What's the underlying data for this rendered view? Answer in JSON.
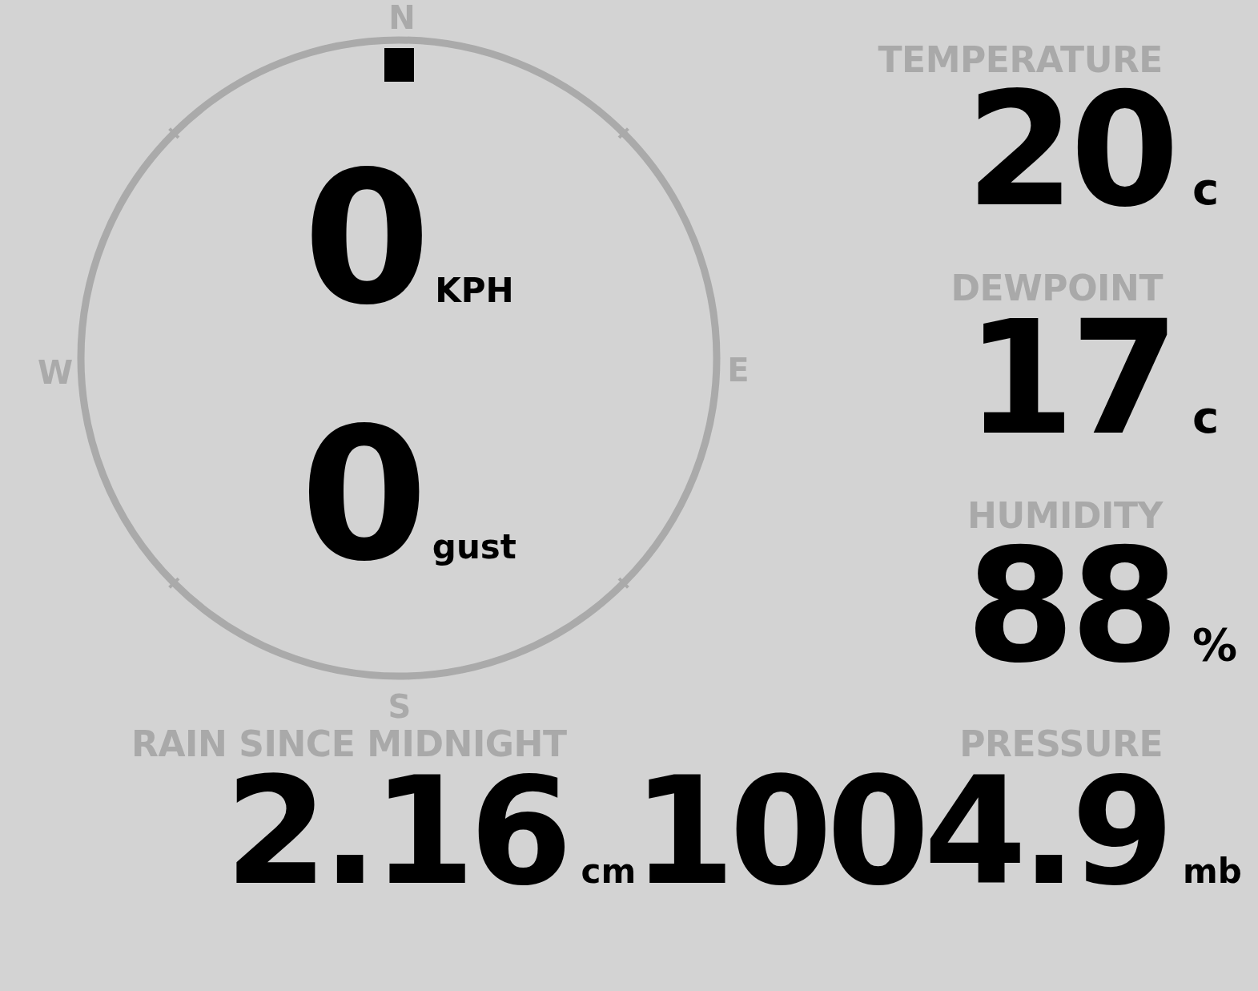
{
  "compass": {
    "labels": [
      "N",
      "E",
      "S",
      "W"
    ]
  },
  "wind": [
    {
      "value": "0",
      "unit": "KPH"
    },
    {
      "value": "0",
      "unit": "gust"
    }
  ],
  "readings": [
    {
      "label": "TEMPERATURE",
      "value": "20",
      "unit": "c"
    },
    {
      "label": "DEWPOINT",
      "value": "17",
      "unit": "c"
    },
    {
      "label": "HUMIDITY",
      "value": "88",
      "unit": "%"
    }
  ],
  "bottom": [
    {
      "label": "RAIN SINCE MIDNIGHT",
      "value": "2.16",
      "unit": "cm"
    },
    {
      "label": "PRESSURE",
      "value": "1004.9",
      "unit": "mb"
    }
  ]
}
